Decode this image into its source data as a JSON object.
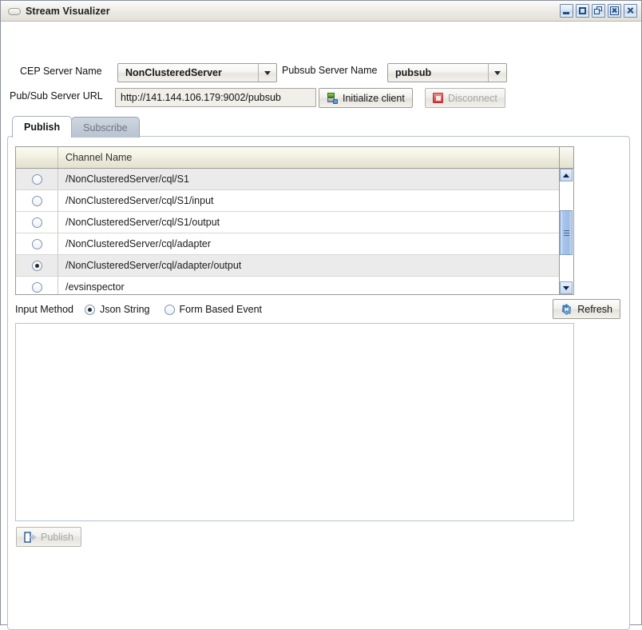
{
  "window": {
    "title": "Stream Visualizer",
    "title_icon": "pill-icon",
    "controls": [
      {
        "name": "minimize-button",
        "icon": "minimize-icon"
      },
      {
        "name": "maximize-button",
        "icon": "maximize-icon"
      },
      {
        "name": "restore-button",
        "icon": "restore-icon"
      },
      {
        "name": "close-boxed-button",
        "icon": "close-boxed-icon"
      },
      {
        "name": "close-button",
        "icon": "close-icon"
      }
    ]
  },
  "form": {
    "cep_server_label": "CEP Server Name",
    "cep_server_value": "NonClusteredServer",
    "pubsub_server_label": "Pubsub Server Name",
    "pubsub_server_value": "pubsub",
    "url_label": "Pub/Sub Server URL",
    "url_value": "http://141.144.106.179:9002/pubsub",
    "initialize_label": "Initialize client",
    "initialize_icon": "server-init-icon",
    "disconnect_label": "Disconnect",
    "disconnect_icon": "stop-square-icon",
    "disconnect_disabled": true
  },
  "tabs": [
    {
      "label": "Publish",
      "active": true
    },
    {
      "label": "Subscribe",
      "active": false
    }
  ],
  "table": {
    "columns": [
      "",
      "Channel Name"
    ],
    "rows": [
      {
        "selected": false,
        "shaded": true,
        "channel": "/NonClusteredServer/cql/S1"
      },
      {
        "selected": false,
        "shaded": false,
        "channel": "/NonClusteredServer/cql/S1/input"
      },
      {
        "selected": false,
        "shaded": false,
        "channel": "/NonClusteredServer/cql/S1/output"
      },
      {
        "selected": false,
        "shaded": false,
        "channel": "/NonClusteredServer/cql/adapter"
      },
      {
        "selected": true,
        "shaded": true,
        "channel": "/NonClusteredServer/cql/adapter/output"
      },
      {
        "selected": false,
        "shaded": false,
        "channel": "/evsinspector"
      }
    ],
    "scrollbar": {
      "up_icon": "scroll-up-icon",
      "down_icon": "scroll-down-icon"
    }
  },
  "input_method": {
    "label": "Input Method",
    "options": [
      {
        "label": "Json String",
        "selected": true
      },
      {
        "label": "Form Based Event",
        "selected": false
      }
    ]
  },
  "refresh": {
    "label": "Refresh",
    "icon": "refresh-icon"
  },
  "editor": {
    "value": "",
    "placeholder": ""
  },
  "publish": {
    "label": "Publish",
    "icon": "publish-arrow-icon",
    "disabled": true
  },
  "colors": {
    "accent_blue": "#1f4e88",
    "scroll_thumb": "#9dbde6",
    "header_cream": "#f3f1e2",
    "stop_red": "#d33a3a",
    "row_shade": "#ebebeb"
  }
}
